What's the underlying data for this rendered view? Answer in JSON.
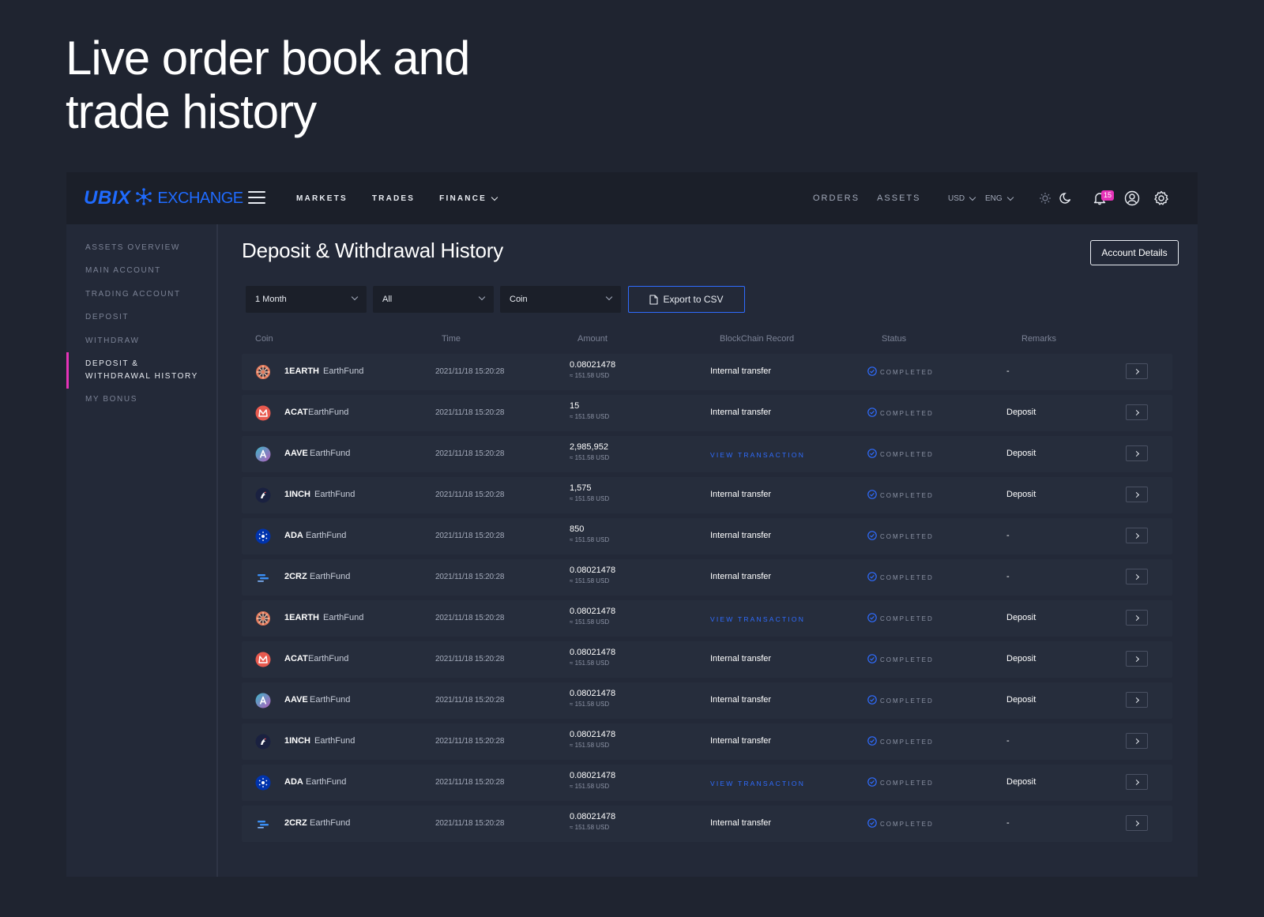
{
  "headline": "Live order book and trade history",
  "brand": {
    "name_bold": "UBIX",
    "name_light": "EXCHANGE",
    "color": "#1f6bff"
  },
  "nav": {
    "main": [
      {
        "label": "MARKETS"
      },
      {
        "label": "TRADES"
      },
      {
        "label": "FINANCE"
      }
    ],
    "right": [
      {
        "label": "ORDERS"
      },
      {
        "label": "ASSETS"
      }
    ],
    "currency": "USD",
    "language": "ENG",
    "notification_count": "15"
  },
  "sidebar": {
    "items": [
      {
        "label": "ASSETS OVERVIEW"
      },
      {
        "label": "MAIN ACCOUNT"
      },
      {
        "label": "TRADING ACCOUNT"
      },
      {
        "label": "DEPOSIT"
      },
      {
        "label": "WITHDRAW"
      },
      {
        "label": "DEPOSIT & WITHDRAWAL HISTORY",
        "active": true
      },
      {
        "label": "MY BONUS"
      }
    ],
    "accent_color": "#e633b8"
  },
  "page": {
    "title": "Deposit & Withdrawal History",
    "account_details_label": "Account Details"
  },
  "filters": {
    "period": "1 Month",
    "type": "All",
    "coin": "Coin",
    "export_label": "Export to CSV"
  },
  "table": {
    "headers": [
      "Coin",
      "Time",
      "Amount",
      "BlockChain Record",
      "Status",
      "Remarks"
    ],
    "rows": [
      {
        "icon": "earth",
        "symbol": "1EARTH",
        "name": "EarthFund",
        "time": "2021/11/18 15:20:28",
        "amount": "0.08021478",
        "usd": "≈ 151.58 USD",
        "record": "Internal transfer",
        "status": "COMPLETED",
        "remark": "-"
      },
      {
        "icon": "acat",
        "symbol": "ACAT",
        "name": "EarthFund",
        "time": "2021/11/18 15:20:28",
        "amount": "15",
        "usd": "≈ 151.58 USD",
        "record": "Internal transfer",
        "status": "COMPLETED",
        "remark": "Deposit"
      },
      {
        "icon": "aave",
        "symbol": "AAVE",
        "name": "EarthFund",
        "time": "2021/11/18 15:20:28",
        "amount": "2,985,952",
        "usd": "≈ 151.58 USD",
        "record": "VIEW TRANSACTION",
        "status": "COMPLETED",
        "remark": "Deposit"
      },
      {
        "icon": "1inch",
        "symbol": "1INCH",
        "name": "EarthFund",
        "time": "2021/11/18 15:20:28",
        "amount": "1,575",
        "usd": "≈ 151.58 USD",
        "record": "Internal transfer",
        "status": "COMPLETED",
        "remark": "Deposit"
      },
      {
        "icon": "ada",
        "symbol": "ADA",
        "name": "EarthFund",
        "time": "2021/11/18 15:20:28",
        "amount": "850",
        "usd": "≈ 151.58 USD",
        "record": "Internal transfer",
        "status": "COMPLETED",
        "remark": "-"
      },
      {
        "icon": "2crz",
        "symbol": "2CRZ",
        "name": "EarthFund",
        "time": "2021/11/18 15:20:28",
        "amount": "0.08021478",
        "usd": "≈ 151.58 USD",
        "record": "Internal transfer",
        "status": "COMPLETED",
        "remark": "-"
      },
      {
        "icon": "earth",
        "symbol": "1EARTH",
        "name": "EarthFund",
        "time": "2021/11/18 15:20:28",
        "amount": "0.08021478",
        "usd": "≈ 151.58 USD",
        "record": "VIEW TRANSACTION",
        "status": "COMPLETED",
        "remark": "Deposit"
      },
      {
        "icon": "acat",
        "symbol": "ACAT",
        "name": "EarthFund",
        "time": "2021/11/18 15:20:28",
        "amount": "0.08021478",
        "usd": "≈ 151.58 USD",
        "record": "Internal transfer",
        "status": "COMPLETED",
        "remark": "Deposit"
      },
      {
        "icon": "aave",
        "symbol": "AAVE",
        "name": "EarthFund",
        "time": "2021/11/18 15:20:28",
        "amount": "0.08021478",
        "usd": "≈ 151.58 USD",
        "record": "Internal transfer",
        "status": "COMPLETED",
        "remark": "Deposit"
      },
      {
        "icon": "1inch",
        "symbol": "1INCH",
        "name": "EarthFund",
        "time": "2021/11/18 15:20:28",
        "amount": "0.08021478",
        "usd": "≈ 151.58 USD",
        "record": "Internal transfer",
        "status": "COMPLETED",
        "remark": "-"
      },
      {
        "icon": "ada",
        "symbol": "ADA",
        "name": "EarthFund",
        "time": "2021/11/18 15:20:28",
        "amount": "0.08021478",
        "usd": "≈ 151.58 USD",
        "record": "VIEW TRANSACTION",
        "status": "COMPLETED",
        "remark": "Deposit"
      },
      {
        "icon": "2crz",
        "symbol": "2CRZ",
        "name": "EarthFund",
        "time": "2021/11/18 15:20:28",
        "amount": "0.08021478",
        "usd": "≈ 151.58 USD",
        "record": "Internal transfer",
        "status": "COMPLETED",
        "remark": "-"
      }
    ]
  }
}
